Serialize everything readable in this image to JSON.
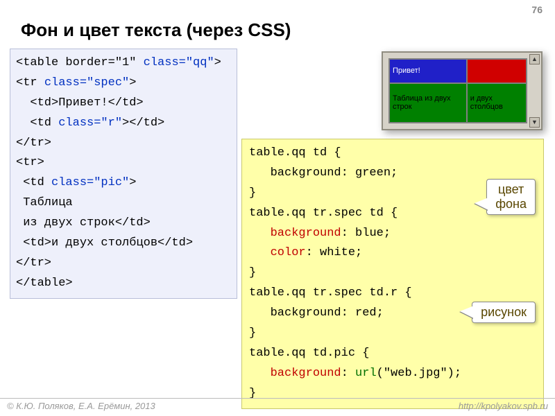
{
  "page_number": "76",
  "title": "Фон и цвет текста (через CSS)",
  "html_code": {
    "l1a": "<table border=\"1\" ",
    "l1b": "class=\"qq\"",
    "l1c": ">",
    "l2a": "<tr ",
    "l2b": "class=\"spec\"",
    "l2c": ">",
    "l3": "  <td>Привет!</td>",
    "l4a": "  <td ",
    "l4b": "class=\"r\"",
    "l4c": "></td>",
    "l5": "</tr>",
    "l6": "<tr>",
    "l7a": " <td ",
    "l7b": "class=\"pic\"",
    "l7c": ">",
    "l8": " Таблица",
    "l9": " из двух строк</td>",
    "l10": " <td>и двух столбцов</td>",
    "l11": "</tr>",
    "l12": "</table>"
  },
  "css_code": {
    "r1": "table.qq td {",
    "r2": "   background: green;",
    "r3": "}",
    "r4": "table.qq tr.spec td {",
    "r5a": "   ",
    "r5b": "background",
    "r5c": ": blue;",
    "r6a": "   ",
    "r6b": "color",
    "r6c": ": white;",
    "r7": "}",
    "r8": "table.qq tr.spec td.r {",
    "r9": "   background: red;",
    "r10": "}",
    "r11": "table.qq td.pic {",
    "r12a": "   ",
    "r12b": "background",
    "r12c": ": ",
    "r12d": "url",
    "r12e": "(\"web.jpg\");",
    "r13": "}"
  },
  "demo_table": {
    "cell1": "Привет!",
    "cell2": "",
    "cell3": "Таблица из двух строк",
    "cell4": "и двух столбцов"
  },
  "callouts": {
    "bg_color": "цвет\nфона",
    "picture": "рисунок"
  },
  "footer": {
    "left": "© К.Ю. Поляков, Е.А. Ерёмин, 2013",
    "right": "http://kpolyakov.spb.ru"
  }
}
